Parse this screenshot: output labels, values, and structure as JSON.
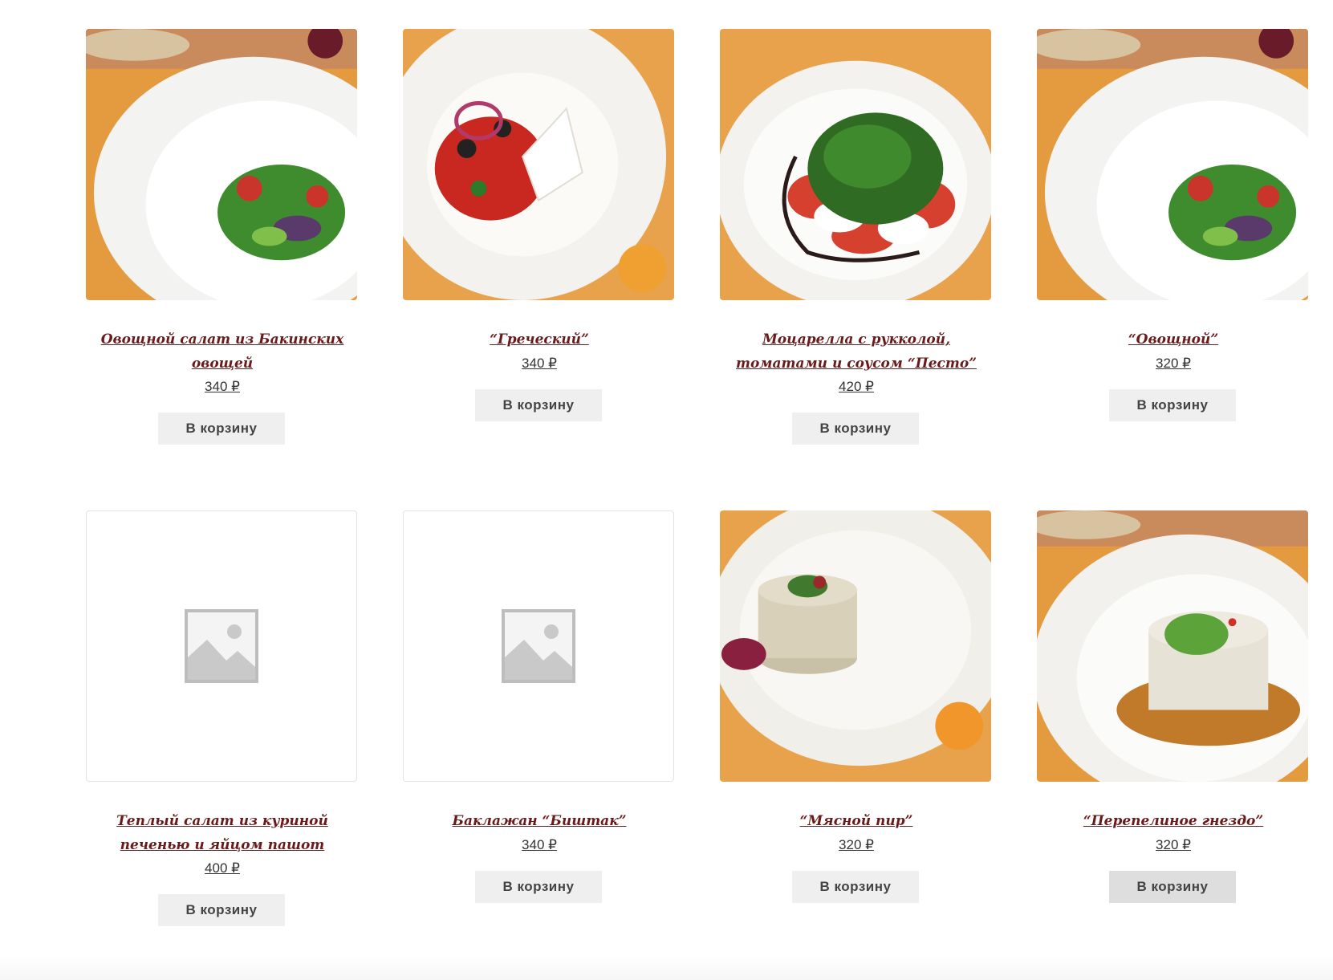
{
  "products": [
    {
      "title": "Овощной салат из Бакинских овощей",
      "price": "340 ₽",
      "button": "В корзину",
      "image": "vegetable-salad-photo"
    },
    {
      "title": "“Греческий”",
      "price": "340 ₽",
      "button": "В корзину",
      "image": "greek-salad-photo"
    },
    {
      "title": "Моцарелла с рукколой, томатами и соусом “Песто”",
      "price": "420 ₽",
      "button": "В корзину",
      "image": "caprese-salad-photo"
    },
    {
      "title": "“Овощной”",
      "price": "320 ₽",
      "button": "В корзину",
      "image": "vegetable-salad-photo"
    },
    {
      "title": "Теплый салат из куриной печенью и яйцом пашот",
      "price": "400 ₽",
      "button": "В корзину",
      "image": "placeholder-image-icon"
    },
    {
      "title": "Баклажан “Биштак”",
      "price": "340 ₽",
      "button": "В корзину",
      "image": "placeholder-image-icon"
    },
    {
      "title": "“Мясной пир”",
      "price": "320 ₽",
      "button": "В корзину",
      "image": "meat-salad-photo"
    },
    {
      "title": "“Перепелиное гнездо”",
      "price": "320 ₽",
      "button": "В корзину",
      "image": "quail-nest-salad-photo"
    }
  ],
  "colors": {
    "title": "#6b1a1a",
    "button_bg": "#efefef",
    "table_bg": "#e8a24c"
  }
}
